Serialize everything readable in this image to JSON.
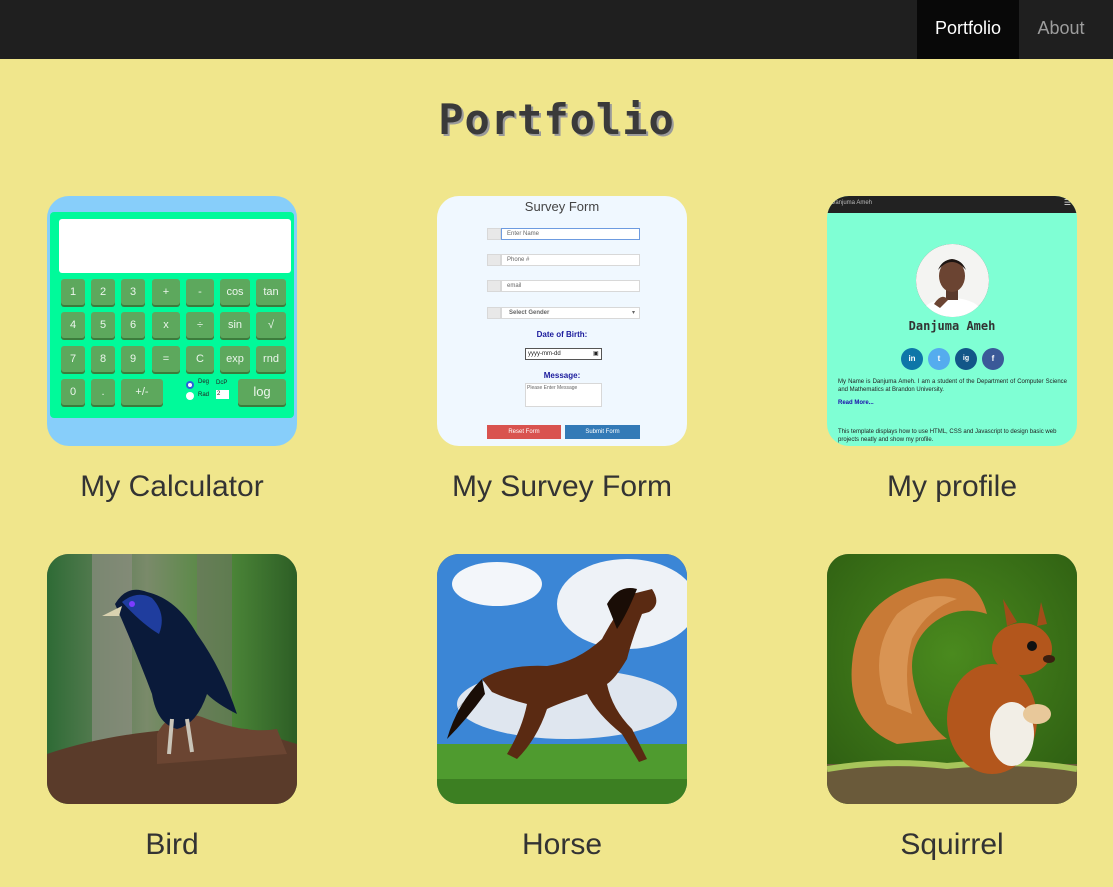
{
  "nav": {
    "links": [
      "Portfolio",
      "About"
    ]
  },
  "page": {
    "title": "Portfolio"
  },
  "projects": [
    {
      "caption": "My Calculator"
    },
    {
      "caption": "My Survey Form"
    },
    {
      "caption": "My profile"
    },
    {
      "caption": "Bird"
    },
    {
      "caption": "Horse"
    },
    {
      "caption": "Squirrel"
    }
  ],
  "calculator_preview": {
    "keys_row1": [
      "1",
      "2",
      "3",
      "+",
      "-",
      "cos",
      "tan"
    ],
    "keys_row2": [
      "4",
      "5",
      "6",
      "x",
      "÷",
      "sin",
      "√"
    ],
    "keys_row3": [
      "7",
      "8",
      "9",
      "=",
      "C",
      "exp",
      "rnd"
    ],
    "keys_row4": [
      "0",
      ".",
      "+/-",
      "log"
    ],
    "deg_label": "Deg",
    "rad_label": "Rad",
    "dp_label": "DcP",
    "dp_value": "2"
  },
  "survey_preview": {
    "title": "Survey Form",
    "name_placeholder": "Enter Name",
    "phone_placeholder": "Phone #",
    "email_placeholder": "email",
    "gender_placeholder": "Select Gender",
    "dob_label": "Date of Birth:",
    "date_placeholder": "yyyy-mm-dd",
    "message_label": "Message:",
    "message_placeholder": "Please Enter Message",
    "reset_label": "Reset Form",
    "submit_label": "Submit Form"
  },
  "profile_preview": {
    "brand": "Danjuma Ameh",
    "name": "Danjuma Ameh",
    "bio": "My Name is Danjuma Ameh. I am a student of the Department of Computer Science and Mathematics at Brandon University.",
    "read_more": "Read More...",
    "footer_text": "This template displays how to use HTML, CSS and Javascript to design basic web projects neatly and show my profile.",
    "social_icons": [
      "in",
      "t",
      "ig",
      "f"
    ]
  },
  "colors": {
    "page_bg": "#f0e68c",
    "navbar_bg": "#1f1f1f",
    "nav_active_bg": "#080808",
    "calc_body": "#00fa9a",
    "calc_frame": "#87cefa",
    "profile_bg": "#7fffd4"
  }
}
